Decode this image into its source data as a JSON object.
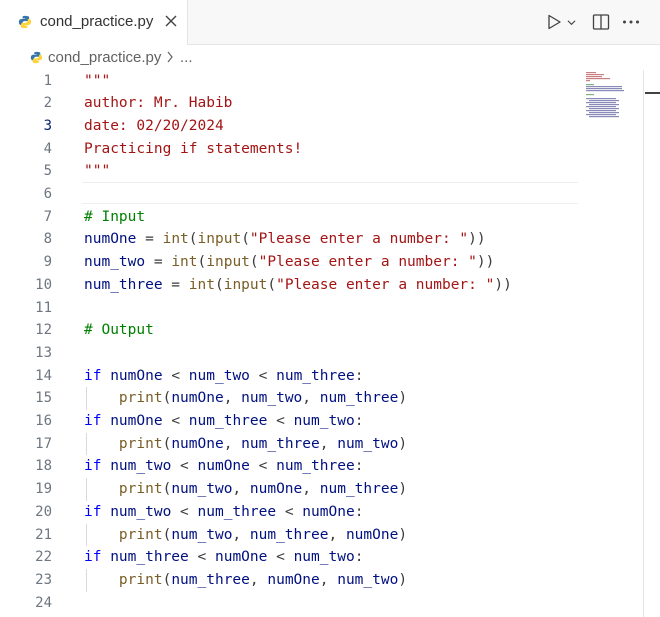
{
  "tab": {
    "filename": "cond_practice.py",
    "close_label": "×"
  },
  "toolbar": {
    "run": "run-icon",
    "split": "split-editor-icon",
    "more": "more-actions-icon"
  },
  "breadcrumb": {
    "file": "cond_practice.py",
    "rest": "..."
  },
  "colors": {
    "string": "#a31515",
    "comment": "#008000",
    "keyword": "#0000ff",
    "function": "#795e26",
    "variable": "#001080",
    "python_blue": "#3776ab",
    "python_yellow": "#ffd43b"
  },
  "editor": {
    "active_line": 3,
    "lines": [
      {
        "n": "1",
        "parts": [
          {
            "t": "\"\"\"",
            "k": "str"
          }
        ]
      },
      {
        "n": "2",
        "parts": [
          {
            "t": "author: Mr. Habib",
            "k": "str"
          }
        ]
      },
      {
        "n": "3",
        "parts": [
          {
            "t": "date: 02/20/2024",
            "k": "str"
          }
        ]
      },
      {
        "n": "4",
        "parts": [
          {
            "t": "Practicing if statements!",
            "k": "str"
          }
        ]
      },
      {
        "n": "5",
        "parts": [
          {
            "t": "\"\"\"",
            "k": "str"
          }
        ]
      },
      {
        "n": "6",
        "parts": []
      },
      {
        "n": "7",
        "parts": [
          {
            "t": "# Input",
            "k": "cmt"
          }
        ]
      },
      {
        "n": "8",
        "parts": [
          {
            "t": "numOne",
            "k": "var"
          },
          {
            "t": " = ",
            "k": "op"
          },
          {
            "t": "int",
            "k": "fn"
          },
          {
            "t": "(",
            "k": "op"
          },
          {
            "t": "input",
            "k": "fn"
          },
          {
            "t": "(",
            "k": "op"
          },
          {
            "t": "\"Please enter a number: \"",
            "k": "str"
          },
          {
            "t": "))",
            "k": "op"
          }
        ]
      },
      {
        "n": "9",
        "parts": [
          {
            "t": "num_two",
            "k": "var"
          },
          {
            "t": " = ",
            "k": "op"
          },
          {
            "t": "int",
            "k": "fn"
          },
          {
            "t": "(",
            "k": "op"
          },
          {
            "t": "input",
            "k": "fn"
          },
          {
            "t": "(",
            "k": "op"
          },
          {
            "t": "\"Please enter a number: \"",
            "k": "str"
          },
          {
            "t": "))",
            "k": "op"
          }
        ]
      },
      {
        "n": "10",
        "parts": [
          {
            "t": "num_three",
            "k": "var"
          },
          {
            "t": " = ",
            "k": "op"
          },
          {
            "t": "int",
            "k": "fn"
          },
          {
            "t": "(",
            "k": "op"
          },
          {
            "t": "input",
            "k": "fn"
          },
          {
            "t": "(",
            "k": "op"
          },
          {
            "t": "\"Please enter a number: \"",
            "k": "str"
          },
          {
            "t": "))",
            "k": "op"
          }
        ]
      },
      {
        "n": "11",
        "parts": []
      },
      {
        "n": "12",
        "parts": [
          {
            "t": "# Output",
            "k": "cmt"
          }
        ]
      },
      {
        "n": "13",
        "parts": []
      },
      {
        "n": "14",
        "parts": [
          {
            "t": "if",
            "k": "kw"
          },
          {
            "t": " ",
            "k": "op"
          },
          {
            "t": "numOne",
            "k": "var"
          },
          {
            "t": " < ",
            "k": "op"
          },
          {
            "t": "num_two",
            "k": "var"
          },
          {
            "t": " < ",
            "k": "op"
          },
          {
            "t": "num_three",
            "k": "var"
          },
          {
            "t": ":",
            "k": "op"
          }
        ]
      },
      {
        "n": "15",
        "parts": [
          {
            "t": "    ",
            "k": "op"
          },
          {
            "t": "print",
            "k": "fn"
          },
          {
            "t": "(",
            "k": "op"
          },
          {
            "t": "numOne",
            "k": "var"
          },
          {
            "t": ", ",
            "k": "op"
          },
          {
            "t": "num_two",
            "k": "var"
          },
          {
            "t": ", ",
            "k": "op"
          },
          {
            "t": "num_three",
            "k": "var"
          },
          {
            "t": ")",
            "k": "op"
          }
        ]
      },
      {
        "n": "16",
        "parts": [
          {
            "t": "if",
            "k": "kw"
          },
          {
            "t": " ",
            "k": "op"
          },
          {
            "t": "numOne",
            "k": "var"
          },
          {
            "t": " < ",
            "k": "op"
          },
          {
            "t": "num_three",
            "k": "var"
          },
          {
            "t": " < ",
            "k": "op"
          },
          {
            "t": "num_two",
            "k": "var"
          },
          {
            "t": ":",
            "k": "op"
          }
        ]
      },
      {
        "n": "17",
        "parts": [
          {
            "t": "    ",
            "k": "op"
          },
          {
            "t": "print",
            "k": "fn"
          },
          {
            "t": "(",
            "k": "op"
          },
          {
            "t": "numOne",
            "k": "var"
          },
          {
            "t": ", ",
            "k": "op"
          },
          {
            "t": "num_three",
            "k": "var"
          },
          {
            "t": ", ",
            "k": "op"
          },
          {
            "t": "num_two",
            "k": "var"
          },
          {
            "t": ")",
            "k": "op"
          }
        ]
      },
      {
        "n": "18",
        "parts": [
          {
            "t": "if",
            "k": "kw"
          },
          {
            "t": " ",
            "k": "op"
          },
          {
            "t": "num_two",
            "k": "var"
          },
          {
            "t": " < ",
            "k": "op"
          },
          {
            "t": "numOne",
            "k": "var"
          },
          {
            "t": " < ",
            "k": "op"
          },
          {
            "t": "num_three",
            "k": "var"
          },
          {
            "t": ":",
            "k": "op"
          }
        ]
      },
      {
        "n": "19",
        "parts": [
          {
            "t": "    ",
            "k": "op"
          },
          {
            "t": "print",
            "k": "fn"
          },
          {
            "t": "(",
            "k": "op"
          },
          {
            "t": "num_two",
            "k": "var"
          },
          {
            "t": ", ",
            "k": "op"
          },
          {
            "t": "numOne",
            "k": "var"
          },
          {
            "t": ", ",
            "k": "op"
          },
          {
            "t": "num_three",
            "k": "var"
          },
          {
            "t": ")",
            "k": "op"
          }
        ]
      },
      {
        "n": "20",
        "parts": [
          {
            "t": "if",
            "k": "kw"
          },
          {
            "t": " ",
            "k": "op"
          },
          {
            "t": "num_two",
            "k": "var"
          },
          {
            "t": " < ",
            "k": "op"
          },
          {
            "t": "num_three",
            "k": "var"
          },
          {
            "t": " < ",
            "k": "op"
          },
          {
            "t": "numOne",
            "k": "var"
          },
          {
            "t": ":",
            "k": "op"
          }
        ]
      },
      {
        "n": "21",
        "parts": [
          {
            "t": "    ",
            "k": "op"
          },
          {
            "t": "print",
            "k": "fn"
          },
          {
            "t": "(",
            "k": "op"
          },
          {
            "t": "num_two",
            "k": "var"
          },
          {
            "t": ", ",
            "k": "op"
          },
          {
            "t": "num_three",
            "k": "var"
          },
          {
            "t": ", ",
            "k": "op"
          },
          {
            "t": "numOne",
            "k": "var"
          },
          {
            "t": ")",
            "k": "op"
          }
        ]
      },
      {
        "n": "22",
        "parts": [
          {
            "t": "if",
            "k": "kw"
          },
          {
            "t": " ",
            "k": "op"
          },
          {
            "t": "num_three",
            "k": "var"
          },
          {
            "t": " < ",
            "k": "op"
          },
          {
            "t": "numOne",
            "k": "var"
          },
          {
            "t": " < ",
            "k": "op"
          },
          {
            "t": "num_two",
            "k": "var"
          },
          {
            "t": ":",
            "k": "op"
          }
        ]
      },
      {
        "n": "23",
        "parts": [
          {
            "t": "    ",
            "k": "op"
          },
          {
            "t": "print",
            "k": "fn"
          },
          {
            "t": "(",
            "k": "op"
          },
          {
            "t": "num_three",
            "k": "var"
          },
          {
            "t": ", ",
            "k": "op"
          },
          {
            "t": "numOne",
            "k": "var"
          },
          {
            "t": ", ",
            "k": "op"
          },
          {
            "t": "num_two",
            "k": "var"
          },
          {
            "t": ")",
            "k": "op"
          }
        ]
      },
      {
        "n": "24",
        "parts": []
      }
    ]
  }
}
